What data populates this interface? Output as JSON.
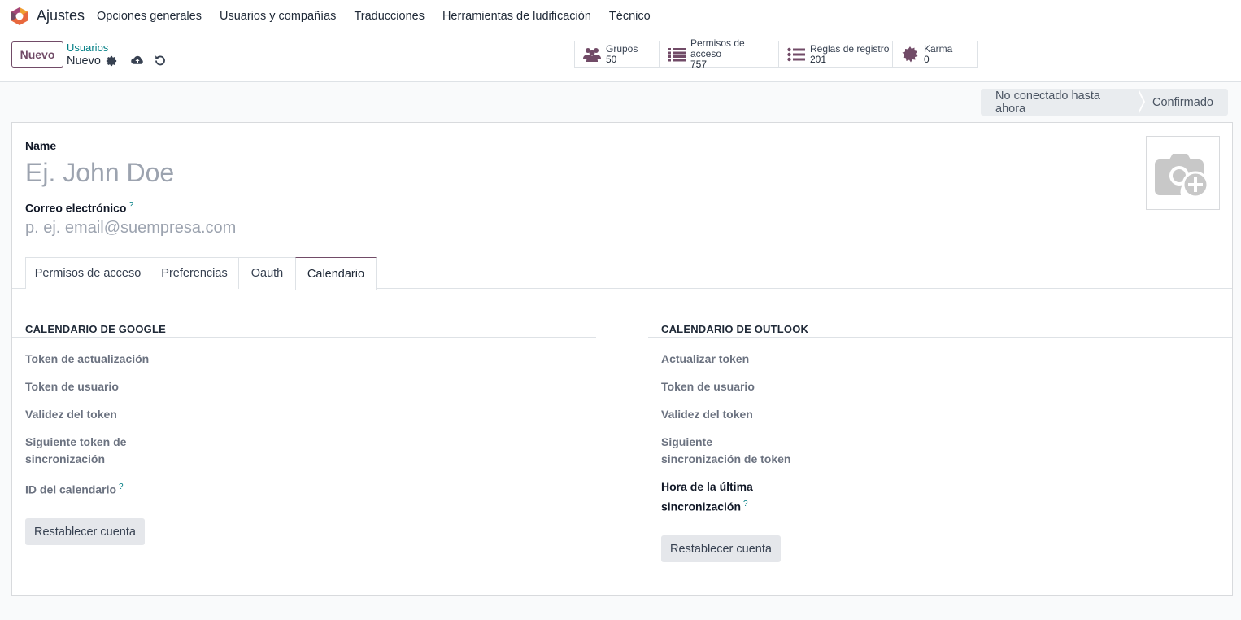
{
  "app": {
    "name": "Ajustes"
  },
  "menu": [
    "Opciones generales",
    "Usuarios y compañías",
    "Traducciones",
    "Herramientas de ludificación",
    "Técnico"
  ],
  "control": {
    "new_button": "Nuevo",
    "breadcrumb_parent": "Usuarios",
    "breadcrumb_current": "Nuevo"
  },
  "stats": [
    {
      "label": "Grupos",
      "value": "50",
      "icon": "users-icon"
    },
    {
      "label": "Permisos de acceso",
      "value": "757",
      "icon": "list-icon"
    },
    {
      "label": "Reglas de registro",
      "value": "201",
      "icon": "list-ul-icon"
    },
    {
      "label": "Karma",
      "value": "0",
      "icon": "karma-icon"
    }
  ],
  "status": {
    "stage1": "No conectado hasta ahora",
    "stage2": "Confirmado"
  },
  "form": {
    "name_label": "Name",
    "name_placeholder": "Ej. John Doe",
    "email_label": "Correo electrónico",
    "email_help": "?",
    "email_placeholder": "p. ej. email@suempresa.com"
  },
  "tabs": [
    "Permisos de acceso",
    "Preferencias",
    "Oauth",
    "Calendario"
  ],
  "google": {
    "title": "CALENDARIO DE GOOGLE",
    "f1": "Token de actualización",
    "f2": "Token de usuario",
    "f3": "Validez del token",
    "f4a": "Siguiente token de",
    "f4b": "sincronización",
    "f5": "ID del calendario",
    "help": "?",
    "button": "Restablecer cuenta"
  },
  "outlook": {
    "title": "CALENDARIO DE OUTLOOK",
    "f1": "Actualizar token",
    "f2": "Token de usuario",
    "f3": "Validez del token",
    "f4a": "Siguiente",
    "f4b": "sincronización de token",
    "f5a": "Hora de la última",
    "f5b": "sincronización",
    "help": "?",
    "button": "Restablecer cuenta"
  },
  "colors": {
    "brand": "#714b67",
    "link": "#017e84"
  }
}
